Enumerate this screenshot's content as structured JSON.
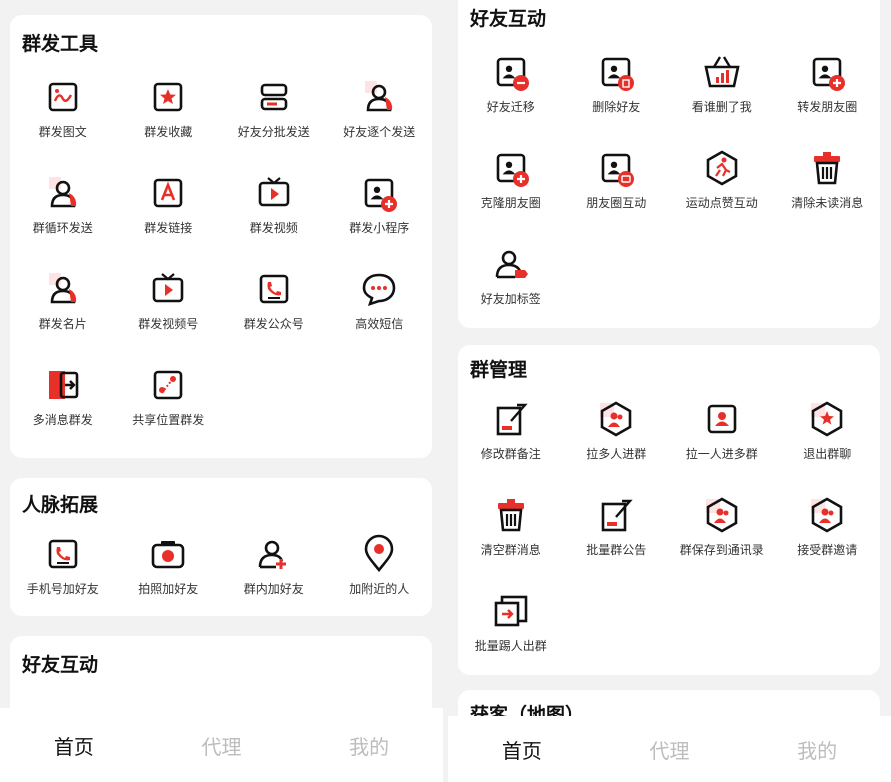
{
  "accent": "#e8302a",
  "left": {
    "mass": {
      "title": "群发工具",
      "items": [
        {
          "label": "群发图文",
          "icon": "image-icon"
        },
        {
          "label": "群发收藏",
          "icon": "star-box-icon"
        },
        {
          "label": "好友分批发送",
          "icon": "batch-send-icon"
        },
        {
          "label": "好友逐个发送",
          "icon": "user-icon"
        },
        {
          "label": "群循环发送",
          "icon": "user-icon"
        },
        {
          "label": "群发链接",
          "icon": "link-a-icon"
        },
        {
          "label": "群发视频",
          "icon": "video-tv-icon"
        },
        {
          "label": "群发小程序",
          "icon": "contact-add-icon"
        },
        {
          "label": "群发名片",
          "icon": "user-icon"
        },
        {
          "label": "群发视频号",
          "icon": "video-tv-icon"
        },
        {
          "label": "群发公众号",
          "icon": "phone-card-icon"
        },
        {
          "label": "高效短信",
          "icon": "chat-bubble-icon"
        },
        {
          "label": "多消息群发",
          "icon": "door-exit-icon"
        },
        {
          "label": "共享位置群发",
          "icon": "map-pin-card-icon"
        }
      ]
    },
    "network": {
      "title": "人脉拓展",
      "items": [
        {
          "label": "手机号加好友",
          "icon": "phone-card-icon"
        },
        {
          "label": "拍照加好友",
          "icon": "camera-icon"
        },
        {
          "label": "群内加好友",
          "icon": "user-add-icon"
        },
        {
          "label": "加附近的人",
          "icon": "location-icon"
        }
      ]
    },
    "friends_peek": {
      "title": "好友互动"
    },
    "tabs": [
      "首页",
      "代理",
      "我的"
    ]
  },
  "right": {
    "friends": {
      "title": "好友互动",
      "items": [
        {
          "label": "好友迁移",
          "icon": "contact-minus-icon"
        },
        {
          "label": "删除好友",
          "icon": "contact-delete-icon"
        },
        {
          "label": "看谁删了我",
          "icon": "basket-chart-icon"
        },
        {
          "label": "转发朋友圈",
          "icon": "contact-add-icon"
        },
        {
          "label": "克隆朋友圈",
          "icon": "contact-add-icon"
        },
        {
          "label": "朋友圈互动",
          "icon": "contact-sync-icon"
        },
        {
          "label": "运动点赞互动",
          "icon": "runner-hexagon-icon"
        },
        {
          "label": "清除未读消息",
          "icon": "trash-icon"
        },
        {
          "label": "好友加标签",
          "icon": "user-tag-icon"
        }
      ]
    },
    "group": {
      "title": "群管理",
      "items": [
        {
          "label": "修改群备注",
          "icon": "edit-note-icon"
        },
        {
          "label": "拉多人进群",
          "icon": "group-hexagon-icon"
        },
        {
          "label": "拉一人进多群",
          "icon": "contact-card-icon"
        },
        {
          "label": "退出群聊",
          "icon": "star-hexagon-icon"
        },
        {
          "label": "清空群消息",
          "icon": "trash-icon"
        },
        {
          "label": "批量群公告",
          "icon": "edit-note-icon"
        },
        {
          "label": "群保存到通讯录",
          "icon": "group-hexagon-icon"
        },
        {
          "label": "接受群邀请",
          "icon": "group-hexagon-icon"
        },
        {
          "label": "批量踢人出群",
          "icon": "kick-copy-icon"
        }
      ]
    },
    "map_peek": {
      "title": "获客（地图）"
    },
    "tabs": [
      "首页",
      "代理",
      "我的"
    ]
  }
}
